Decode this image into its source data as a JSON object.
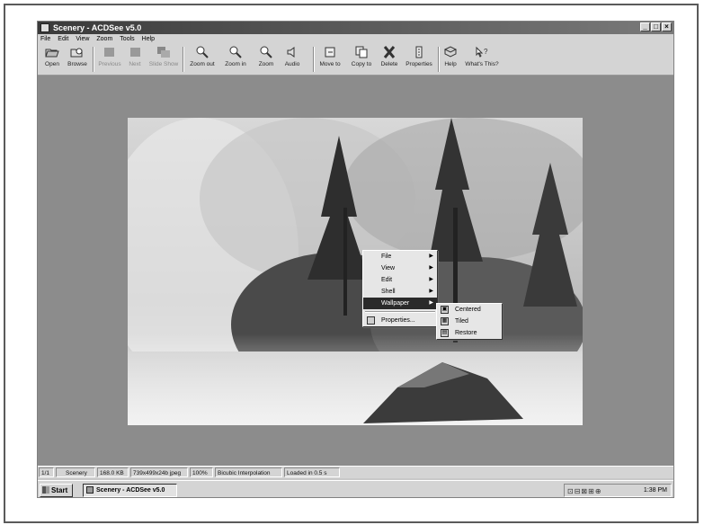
{
  "window": {
    "title": "Scenery - ACDSee v5.0",
    "controls": {
      "minimize": "_",
      "maximize": "□",
      "close": "×"
    }
  },
  "menu": [
    "File",
    "Edit",
    "View",
    "Zoom",
    "Tools",
    "Help"
  ],
  "toolbar": {
    "open": "Open",
    "browse": "Browse",
    "previous": "Previous",
    "next": "Next",
    "slideshow": "Slide Show",
    "zoom_out": "Zoom out",
    "zoom_in": "Zoom in",
    "zoom": "Zoom",
    "audio": "Audio",
    "move_to": "Move to",
    "copy_to": "Copy to",
    "delete": "Delete",
    "properties": "Properties",
    "help": "Help",
    "whats_this": "What's This?"
  },
  "context_menu": {
    "items": [
      "File",
      "View",
      "Edit",
      "Shell",
      "Wallpaper",
      "Properties..."
    ],
    "submenu": [
      "Centered",
      "Tiled",
      "Restore"
    ]
  },
  "statusbar": {
    "position": "1/1",
    "filename": "Scenery",
    "filesize": "168.0 KB",
    "info": "739x499x24b jpeg",
    "zoom": "100%",
    "interpolation": "Bicubic Interpolation",
    "load": "Loaded in 0.5 s"
  },
  "taskbar": {
    "start": "Start",
    "task": "Scenery - ACDSee v5.0",
    "clock": "1:38 PM"
  },
  "icons": {
    "open": "folder-open-icon",
    "browse": "browse-icon",
    "zoom": "magnifier-icon",
    "audio": "speaker-icon",
    "delete": "delete-x-icon",
    "help": "help-book-icon"
  }
}
